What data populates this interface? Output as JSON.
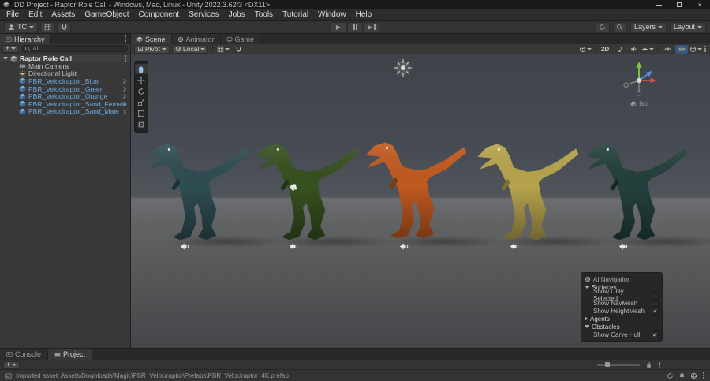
{
  "window": {
    "title": "DD Project - Raptor Role Call - Windows, Mac, Linux - Unity 2022.3.62f3 <DX11>",
    "close_glyph": "×"
  },
  "menu": {
    "items": [
      "File",
      "Edit",
      "Assets",
      "GameObject",
      "Component",
      "Services",
      "Jobs",
      "Tools",
      "Tutorial",
      "Window",
      "Help"
    ]
  },
  "toolbar": {
    "version_control_label": "TC",
    "play_glyph": "▶",
    "step_glyph": "▶",
    "layers_label": "Layers",
    "layout_label": "Layout"
  },
  "hierarchy": {
    "title": "Hierarchy",
    "add_label": "+",
    "search_placeholder": "All",
    "scene_name": "Raptor Role Call",
    "items": [
      {
        "label": "Main Camera",
        "type": "camera"
      },
      {
        "label": "Directional Light",
        "type": "light"
      },
      {
        "label": "PBR_Velociraptor_Blue",
        "type": "prefab"
      },
      {
        "label": "PBR_Velociraptor_Green",
        "type": "prefab"
      },
      {
        "label": "PBR_Velociraptor_Orange",
        "type": "prefab"
      },
      {
        "label": "PBR_Velociraptor_Sand_Female",
        "type": "prefab"
      },
      {
        "label": "PBR_Velociraptor_Sand_Male",
        "type": "prefab"
      }
    ],
    "prefab_text_color": "#6ca9dd"
  },
  "scene_view": {
    "tabs": [
      {
        "label": "Scene"
      },
      {
        "label": "Animator"
      },
      {
        "label": "Game"
      }
    ],
    "active_tab": "Scene",
    "toolbar": {
      "pivot_label": "Pivot",
      "local_label": "Local",
      "two_d_label": "2D"
    },
    "orientation_label": "Iso"
  },
  "viewport": {
    "raptors": [
      {
        "name": "PBR_Velociraptor_Blue",
        "color": "#2e4d52",
        "shade": "#1b3034"
      },
      {
        "name": "PBR_Velociraptor_Green",
        "color": "#37501f",
        "shade": "#223413"
      },
      {
        "name": "PBR_Velociraptor_Orange",
        "color": "#c05a1f",
        "shade": "#7c3a12"
      },
      {
        "name": "PBR_Velociraptor_Sand_Female",
        "color": "#b5a34d",
        "shade": "#7d7033"
      },
      {
        "name": "PBR_Velociraptor_Sand_Male",
        "color": "#24403c",
        "shade": "#152824"
      }
    ]
  },
  "ai_navigation": {
    "title": "AI Navigation",
    "rows": [
      {
        "label": "Surfaces",
        "kind": "section",
        "expanded": true,
        "check": ""
      },
      {
        "label": "Show Only Selected",
        "kind": "item",
        "check": ""
      },
      {
        "label": "Show NavMesh",
        "kind": "item",
        "check": ""
      },
      {
        "label": "Show HeightMesh",
        "kind": "item",
        "check": "✓"
      },
      {
        "label": "Agents",
        "kind": "section",
        "expanded": false,
        "check": ""
      },
      {
        "label": "Obstacles",
        "kind": "section",
        "expanded": true,
        "check": ""
      },
      {
        "label": "Show Carve Hull",
        "kind": "item",
        "check": "✓"
      }
    ]
  },
  "bottom_panel": {
    "tabs": [
      {
        "label": "Console"
      },
      {
        "label": "Project"
      }
    ],
    "active_tab": "Project",
    "add_label": "+"
  },
  "status_bar": {
    "message": "Imported asset: Assets\\Downloads\\Magic\\PBR_Velociraptor\\Prefabs\\PBR_Velociraptor_4K.prefab"
  }
}
